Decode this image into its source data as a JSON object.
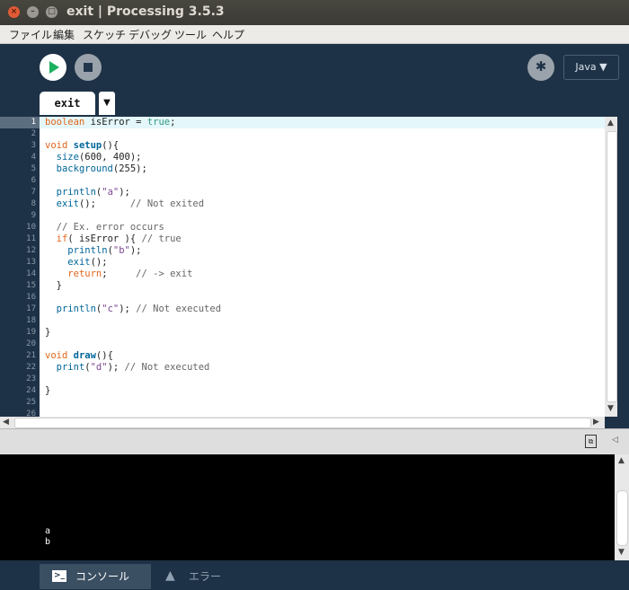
{
  "window": {
    "title": "exit | Processing 3.5.3"
  },
  "menu": [
    "ファイル",
    "編集",
    "スケッチ",
    "デバッグ",
    "ツール",
    "ヘルプ"
  ],
  "toolbar": {
    "mode": "Java ▼"
  },
  "tabs": [
    {
      "label": "exit"
    }
  ],
  "tab_menu": "▼",
  "line_numbers": [
    "1",
    "2",
    "3",
    "4",
    "5",
    "6",
    "7",
    "8",
    "9",
    "10",
    "11",
    "12",
    "13",
    "14",
    "15",
    "16",
    "17",
    "18",
    "19",
    "20",
    "21",
    "22",
    "23",
    "24",
    "25",
    "26"
  ],
  "code": [
    "boolean isError = true;",
    "",
    "void setup(){",
    "  size(600, 400);",
    "  background(255);",
    "",
    "  println(\"a\");",
    "  exit();      // Not exited",
    "",
    "  // Ex. error occurs",
    "  if( isError ){ // true",
    "    println(\"b\");",
    "    exit();",
    "    return;     // -> exit",
    "  }",
    "",
    "  println(\"c\"); // Not executed",
    "",
    "}",
    "",
    "void draw(){",
    "  print(\"d\"); // Not executed",
    "",
    "}",
    "",
    ""
  ],
  "console": {
    "lines": [
      "a",
      "b"
    ]
  },
  "footer_tabs": [
    {
      "label": "コンソール",
      "active": true
    },
    {
      "label": "エラー",
      "active": false
    }
  ],
  "colors": {
    "background": "#1e3247",
    "run": "#1bb15d",
    "keyword": "#e2661a",
    "function": "#006699",
    "string": "#7d4793",
    "comment": "#666666"
  }
}
